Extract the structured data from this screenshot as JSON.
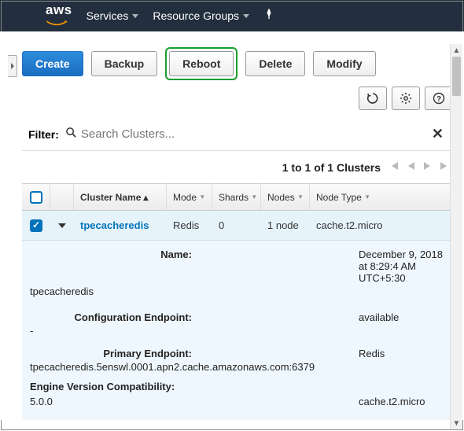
{
  "topbar": {
    "logo_text": "aws",
    "nav": {
      "services": "Services",
      "resource_groups": "Resource Groups"
    }
  },
  "toolbar": {
    "create": "Create",
    "backup": "Backup",
    "reboot": "Reboot",
    "delete": "Delete",
    "modify": "Modify"
  },
  "icons": {
    "refresh": "⟳",
    "settings": "✱",
    "help": "?"
  },
  "filter": {
    "label": "Filter:",
    "placeholder": "Search Clusters...",
    "clear": "✕"
  },
  "pager": {
    "text": "1 to 1 of 1 Clusters",
    "first": "|◀",
    "prev": "◀",
    "next": "▶",
    "last": "▶|"
  },
  "columns": {
    "cluster_name": "Cluster Name",
    "mode": "Mode",
    "shards": "Shards",
    "nodes": "Nodes",
    "node_type": "Node Type"
  },
  "row": {
    "cluster_name": "tpecacheredis",
    "mode": "Redis",
    "shards": "0",
    "nodes": "1 node",
    "node_type": "cache.t2.micro"
  },
  "details": {
    "name_label": "Name:",
    "name_value": "tpecacheredis",
    "created": "December 9, 2018 at 8:29:4 AM UTC+5:30",
    "config_ep_label": "Configuration Endpoint:",
    "config_ep_value": "-",
    "status": "available",
    "primary_ep_label": "Primary Endpoint:",
    "primary_ep_value": "tpecacheredis.5enswl.0001.apn2.cache.amazonaws.com:6379",
    "engine": "Redis",
    "engine_compat_label": "Engine Version Compatibility:",
    "engine_compat_value": "5.0.0",
    "node_type": "cache.t2.micro"
  }
}
